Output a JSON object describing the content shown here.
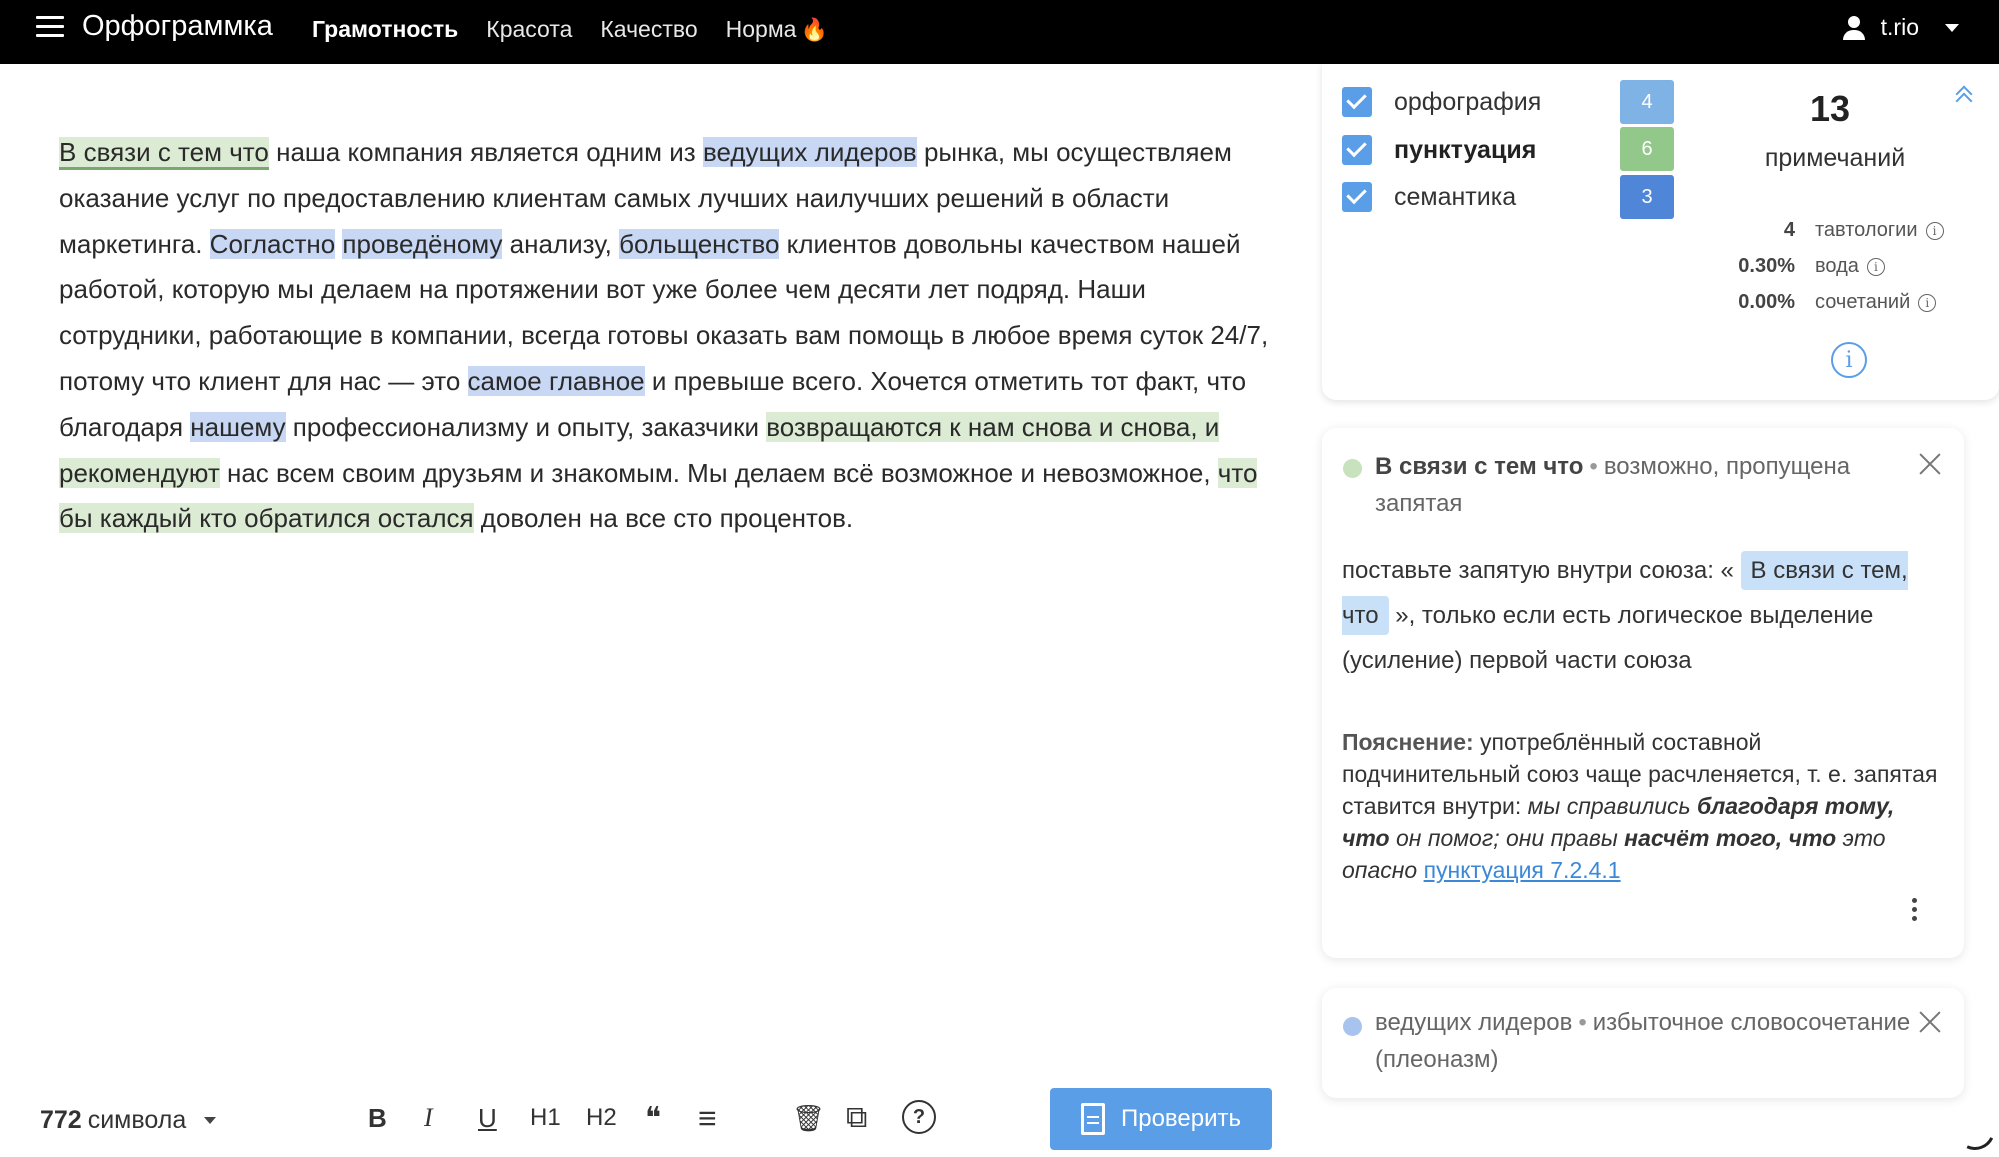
{
  "app": {
    "title": "Орфограммка"
  },
  "nav": {
    "items": [
      {
        "label": "Грамотность",
        "active": true
      },
      {
        "label": "Красота",
        "active": false
      },
      {
        "label": "Качество",
        "active": false
      },
      {
        "label": "Норма",
        "active": false
      }
    ],
    "flame_icon": "flame-icon"
  },
  "user": {
    "name": "t.rio",
    "icon": "user-icon"
  },
  "editor": {
    "segments": [
      {
        "text": "В связи с тем что",
        "hl": "green-ul"
      },
      {
        "text": " наша компания является одним из "
      },
      {
        "text": "ведущих лидеров",
        "hl": "blue"
      },
      {
        "text": " рынка, мы осуществляем оказание услуг по предоставлению клиентам самых лучших наилучших решений в области маркетинга. "
      },
      {
        "text": "Согластно",
        "hl": "blue"
      },
      {
        "text": " "
      },
      {
        "text": "проведёному",
        "hl": "blue"
      },
      {
        "text": " анализу, "
      },
      {
        "text": "больщенство",
        "hl": "blue"
      },
      {
        "text": " клиентов довольны качеством нашей работой, которую мы делаем на протяжении вот уже более чем десяти лет подряд. Наши сотрудники, работающие в компании, всегда готовы оказать вам помощь в любое время суток 24/7, потому что клиент для нас — это "
      },
      {
        "text": "самое главное",
        "hl": "blue"
      },
      {
        "text": " и превыше всего. Хочется отметить тот факт, что благодаря "
      },
      {
        "text": "нашему",
        "hl": "blue"
      },
      {
        "text": " профессионализму и опыту, заказчики "
      },
      {
        "text": "возвращаются к нам снова и снова, и рекомендуют",
        "hl": "green"
      },
      {
        "text": " нас всем своим друзьям и знакомым. Мы делаем всё возможное и невозможное, "
      },
      {
        "text": "что бы каждый кто обратился остался",
        "hl": "green"
      },
      {
        "text": " доволен на все сто процентов."
      }
    ]
  },
  "toolbar": {
    "char_count": "772",
    "char_label": "символа",
    "format": {
      "bold": "B",
      "italic": "I",
      "underline": "U",
      "h1": "H1",
      "h2": "H2",
      "quote": "❝",
      "align": "≡",
      "delete": "🗑",
      "copy": "⧉",
      "help": "?"
    },
    "check_label": "Проверить"
  },
  "stats": {
    "categories": [
      {
        "label": "орфография",
        "count": "4",
        "color": "#7fb3e6",
        "bold": false
      },
      {
        "label": "пунктуация",
        "count": "6",
        "color": "#92c88a",
        "bold": true
      },
      {
        "label": "семантика",
        "count": "3",
        "color": "#4f86d8",
        "bold": false
      }
    ],
    "total": "13",
    "total_label": "примечаний",
    "metrics": [
      {
        "value": "4",
        "label": "тавтологии"
      },
      {
        "value": "0.30%",
        "label": "вода"
      },
      {
        "value": "0.00%",
        "label": "сочетаний"
      }
    ],
    "info_glyph": "i"
  },
  "suggestions": [
    {
      "dot_color": "#c7e2bd",
      "phrase": "В связи с тем что",
      "sep": "•",
      "type": "возможно, пропущена запятая",
      "body_before": "поставьте запятую внутри союза: «",
      "body_chip": "В связи с тем, что",
      "body_after": "», только если есть логическое выделение (усиление) первой части союза",
      "expl_label": "Пояснение:",
      "expl_text": "употреблённый составной подчинительный союз чаще расчленяется, т. е. запятая ставится внутри:",
      "ex1_a": "мы справились",
      "ex1_b": "благодаря тому, что",
      "ex1_c": "он помог; они правы",
      "ex2_b": "насчёт того, что",
      "ex2_c": "это опасно",
      "link": "пунктуация 7.2.4.1"
    },
    {
      "dot_color": "#a8c4ee",
      "phrase": "ведущих лидеров",
      "sep": "•",
      "type": "избыточное словосочетание (плеоназм)"
    }
  ]
}
